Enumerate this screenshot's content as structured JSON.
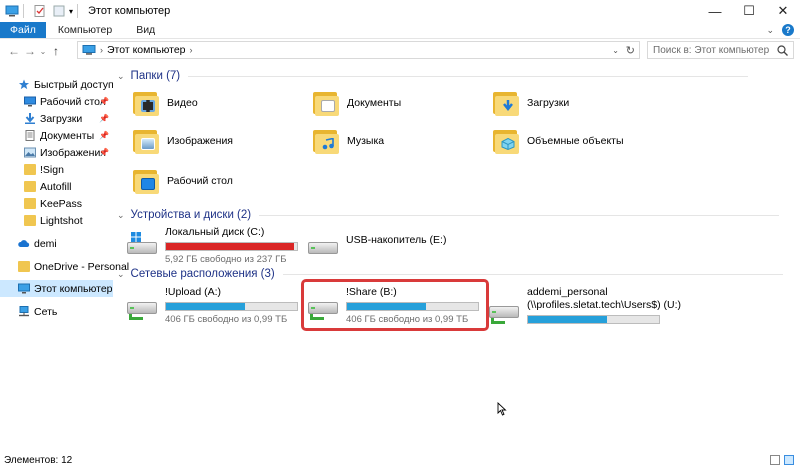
{
  "window": {
    "title": "Этот компьютер"
  },
  "ribbon": {
    "tabs": [
      "Файл",
      "Компьютер",
      "Вид"
    ]
  },
  "address": {
    "path": "Этот компьютер",
    "search_placeholder": "Поиск в: Этот компьютер"
  },
  "sidebar": {
    "items": [
      {
        "label": "Быстрый доступ",
        "icon": "star-icon"
      },
      {
        "label": "Рабочий стол",
        "icon": "desktop-icon",
        "pinned": true
      },
      {
        "label": "Загрузки",
        "icon": "download-icon",
        "pinned": true
      },
      {
        "label": "Документы",
        "icon": "documents-icon",
        "pinned": true
      },
      {
        "label": "Изображения",
        "icon": "pictures-icon",
        "pinned": true
      },
      {
        "label": "!Sign",
        "icon": "folder-icon"
      },
      {
        "label": "Autofill",
        "icon": "folder-icon"
      },
      {
        "label": "KeePass",
        "icon": "folder-icon"
      },
      {
        "label": "Lightshot",
        "icon": "folder-icon"
      },
      {
        "label": "demi",
        "icon": "onedrive-cloud-icon"
      },
      {
        "label": "OneDrive - Personal",
        "icon": "folder-icon"
      },
      {
        "label": "Этот компьютер",
        "icon": "computer-icon",
        "selected": true
      },
      {
        "label": "Сеть",
        "icon": "network-icon"
      }
    ]
  },
  "groups": {
    "folders": "Папки (7)",
    "devices": "Устройства и диски (2)",
    "network": "Сетевые расположения (3)"
  },
  "folders": [
    {
      "label": "Видео",
      "icon": "video-folder-icon"
    },
    {
      "label": "Документы",
      "icon": "documents-folder-icon"
    },
    {
      "label": "Загрузки",
      "icon": "downloads-folder-icon"
    },
    {
      "label": "Изображения",
      "icon": "pictures-folder-icon"
    },
    {
      "label": "Музыка",
      "icon": "music-folder-icon"
    },
    {
      "label": "Объемные объекты",
      "icon": "3d-objects-folder-icon"
    },
    {
      "label": "Рабочий стол",
      "icon": "desktop-folder-icon"
    }
  ],
  "drives": [
    {
      "name": "Локальный диск (C:)",
      "free": "5,92 ГБ свободно из 237 ГБ",
      "used_fraction": 0.975,
      "bar_color": "#da2626"
    },
    {
      "name": "USB-накопитель (E:)"
    }
  ],
  "network_locations": [
    {
      "name": "!Upload (A:)",
      "free": "406 ГБ свободно из 0,99 ТБ",
      "used_fraction": 0.6,
      "bar_color": "#26a0da"
    },
    {
      "name": "!Share (B:)",
      "free": "406 ГБ свободно из 0,99 ТБ",
      "used_fraction": 0.6,
      "bar_color": "#26a0da"
    },
    {
      "name": "addemi_personal",
      "name2": "(\\\\profiles.sletat.tech\\Users$) (U:)",
      "used_fraction": 0.6,
      "bar_color": "#26a0da"
    }
  ],
  "status": {
    "items_count": "Элементов: 12"
  }
}
